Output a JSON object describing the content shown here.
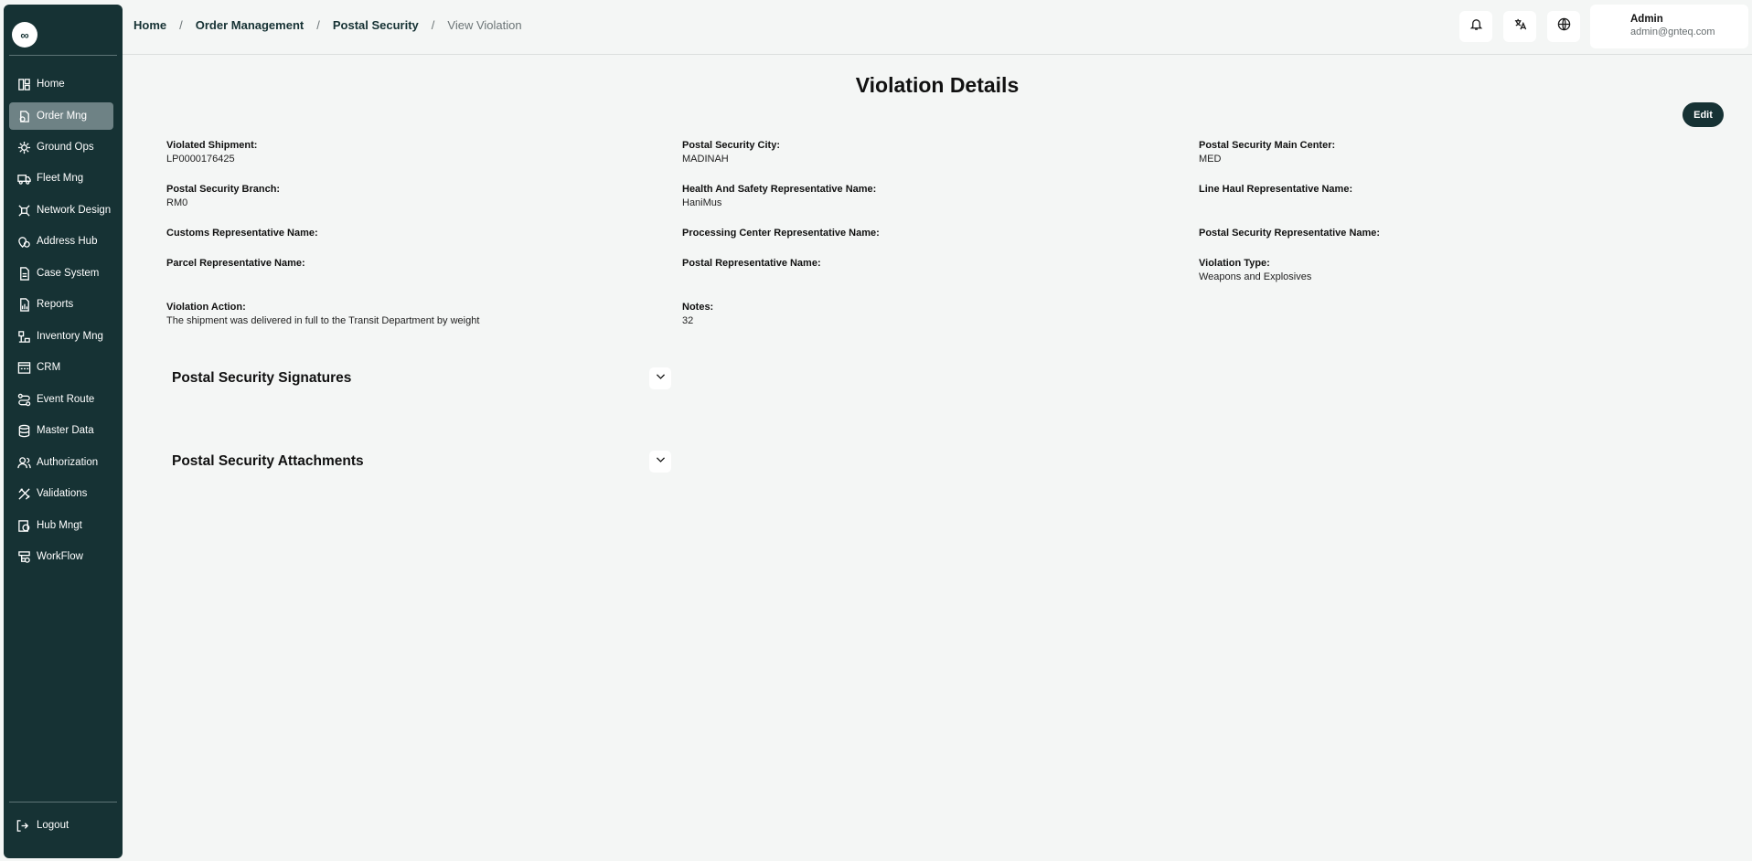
{
  "sidebar": {
    "logo_symbol": "∞",
    "items": [
      {
        "label": "Home",
        "icon": "home-icon"
      },
      {
        "label": "Order Mng",
        "icon": "order-icon",
        "active": true
      },
      {
        "label": "Ground Ops",
        "icon": "ground-ops-icon"
      },
      {
        "label": "Fleet Mng",
        "icon": "truck-icon"
      },
      {
        "label": "Network Design",
        "icon": "network-icon"
      },
      {
        "label": "Address Hub",
        "icon": "address-icon"
      },
      {
        "label": "Case System",
        "icon": "case-icon"
      },
      {
        "label": "Reports",
        "icon": "reports-icon"
      },
      {
        "label": "Inventory Mng",
        "icon": "inventory-icon"
      },
      {
        "label": "CRM",
        "icon": "crm-icon"
      },
      {
        "label": "Event Route",
        "icon": "route-icon"
      },
      {
        "label": "Master Data",
        "icon": "database-icon"
      },
      {
        "label": "Authorization",
        "icon": "users-icon"
      },
      {
        "label": "Validations",
        "icon": "validations-icon"
      },
      {
        "label": "Hub Mngt",
        "icon": "hub-icon"
      },
      {
        "label": "WorkFlow",
        "icon": "workflow-icon"
      }
    ],
    "logout_label": "Logout"
  },
  "header": {
    "breadcrumb": [
      "Home",
      "Order Management",
      "Postal Security",
      "View Violation"
    ],
    "separator": "/",
    "user": {
      "name": "Admin",
      "email": "admin@gnteq.com"
    }
  },
  "main": {
    "title": "Violation Details",
    "edit_label": "Edit",
    "fields": [
      {
        "label": "Violated Shipment:",
        "value": "LP0000176425"
      },
      {
        "label": "Postal Security City:",
        "value": "MADINAH"
      },
      {
        "label": "Postal Security Main Center:",
        "value": "MED"
      },
      {
        "label": "Postal Security Branch:",
        "value": "RM0"
      },
      {
        "label": "Health And Safety Representative Name:",
        "value": "HaniMus"
      },
      {
        "label": "Line Haul Representative Name:",
        "value": ""
      },
      {
        "label": "Customs Representative Name:",
        "value": ""
      },
      {
        "label": "Processing Center Representative Name:",
        "value": ""
      },
      {
        "label": "Postal Security Representative Name:",
        "value": ""
      },
      {
        "label": "Parcel Representative Name:",
        "value": ""
      },
      {
        "label": "Postal Representative Name:",
        "value": ""
      },
      {
        "label": "Violation Type:",
        "value": "Weapons and Explosives"
      },
      {
        "label": "Violation Action:",
        "value": "The shipment was delivered in full to the Transit Department by weight"
      },
      {
        "label": "Notes:",
        "value": "32"
      }
    ],
    "sections": [
      {
        "title": "Postal Security Signatures",
        "expanded": false
      },
      {
        "title": "Postal Security Attachments",
        "expanded": false
      }
    ]
  },
  "colors": {
    "sidebar_bg": "#163234",
    "active_item_bg": "#6e8285",
    "page_bg": "#f4f6f5",
    "accent": "#163234"
  }
}
